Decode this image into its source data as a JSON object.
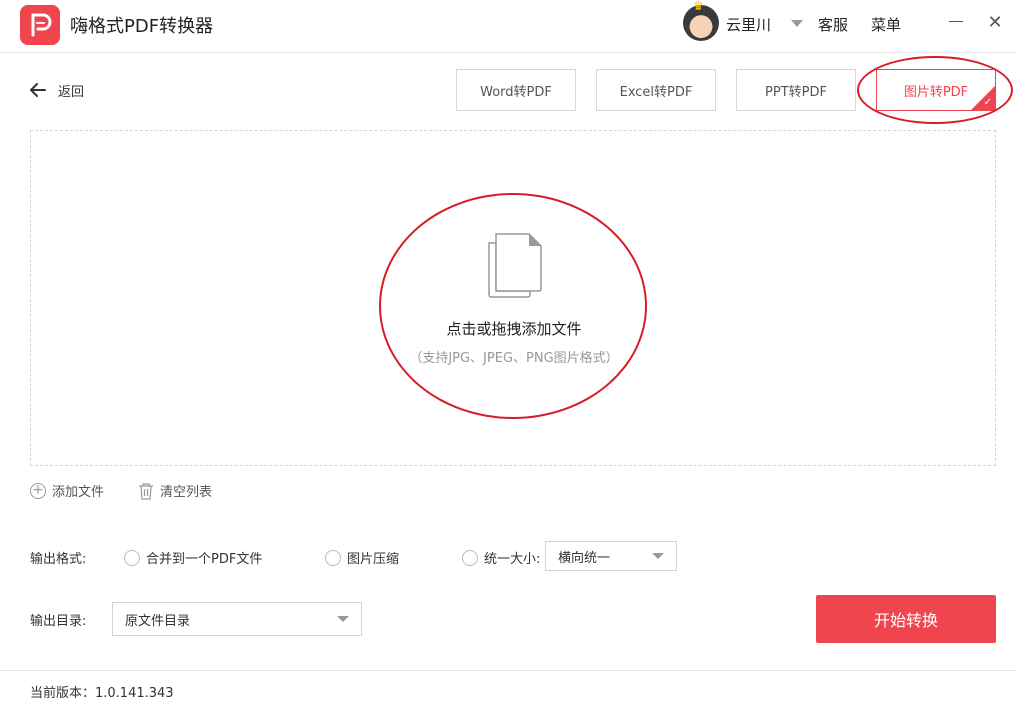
{
  "app": {
    "title": "嗨格式PDF转换器",
    "accent": "#f0454e"
  },
  "user": {
    "name": "云里川",
    "service_label": "客服",
    "menu_label": "菜单"
  },
  "nav": {
    "back_label": "返回"
  },
  "tabs": [
    {
      "label": "Word转PDF",
      "active": false
    },
    {
      "label": "Excel转PDF",
      "active": false
    },
    {
      "label": "PPT转PDF",
      "active": false
    },
    {
      "label": "图片转PDF",
      "active": true
    }
  ],
  "dropzone": {
    "title": "点击或拖拽添加文件",
    "subtitle": "（支持JPG、JPEG、PNG图片格式）"
  },
  "list_actions": {
    "add_label": "添加文件",
    "clear_label": "清空列表"
  },
  "output_format": {
    "label": "输出格式:",
    "options": [
      {
        "label": "合并到一个PDF文件",
        "checked": false
      },
      {
        "label": "图片压缩",
        "checked": false
      },
      {
        "label": "统一大小:",
        "checked": false
      }
    ],
    "size_select_value": "横向统一"
  },
  "output_dir": {
    "label": "输出目录:",
    "value": "原文件目录"
  },
  "start_button": {
    "label": "开始转换"
  },
  "footer": {
    "version_label": "当前版本：1.0.141.343"
  },
  "colors": {
    "accent": "#f0454e",
    "annotation_ring": "#d61d26"
  }
}
